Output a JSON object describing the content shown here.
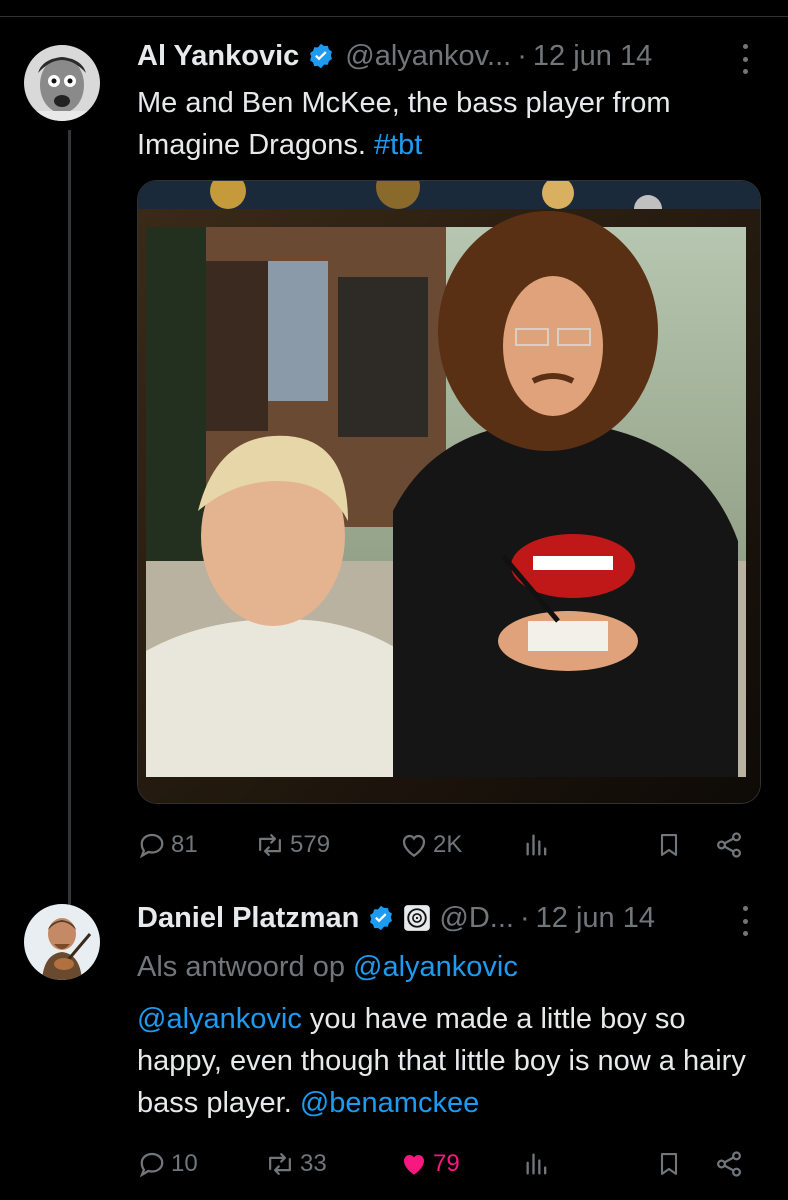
{
  "thread": [
    {
      "author": {
        "name": "Al Yankovic",
        "handle": "@alyankov...",
        "verified": true
      },
      "date": "12 jun 14",
      "text_plain": "Me and Ben McKee, the bass player from Imagine Dragons. ",
      "hashtag": "#tbt",
      "media": "photo-icon",
      "stats": {
        "replies": "81",
        "reposts": "579",
        "likes": "2K"
      }
    },
    {
      "author": {
        "name": "Daniel Platzman",
        "handle": "@D...",
        "verified": true,
        "affiliate_badge": "record-label-icon"
      },
      "date": "12 jun 14",
      "reply_to_prefix": "Als antwoord op ",
      "reply_to_handle": "@alyankovic",
      "mention_start": "@alyankovic",
      "text_plain": " you have made a little boy so happy, even though that little boy is now a hairy bass player. ",
      "mention_end": "@benamckee",
      "stats": {
        "replies": "10",
        "reposts": "33",
        "likes": "79",
        "liked": true
      }
    }
  ],
  "separator": "·",
  "colors": {
    "background": "#000000",
    "text": "#e7e9ea",
    "muted": "#71767b",
    "link": "#1d9bf0",
    "like_active": "#f91880",
    "verified": "#1d9bf0"
  }
}
